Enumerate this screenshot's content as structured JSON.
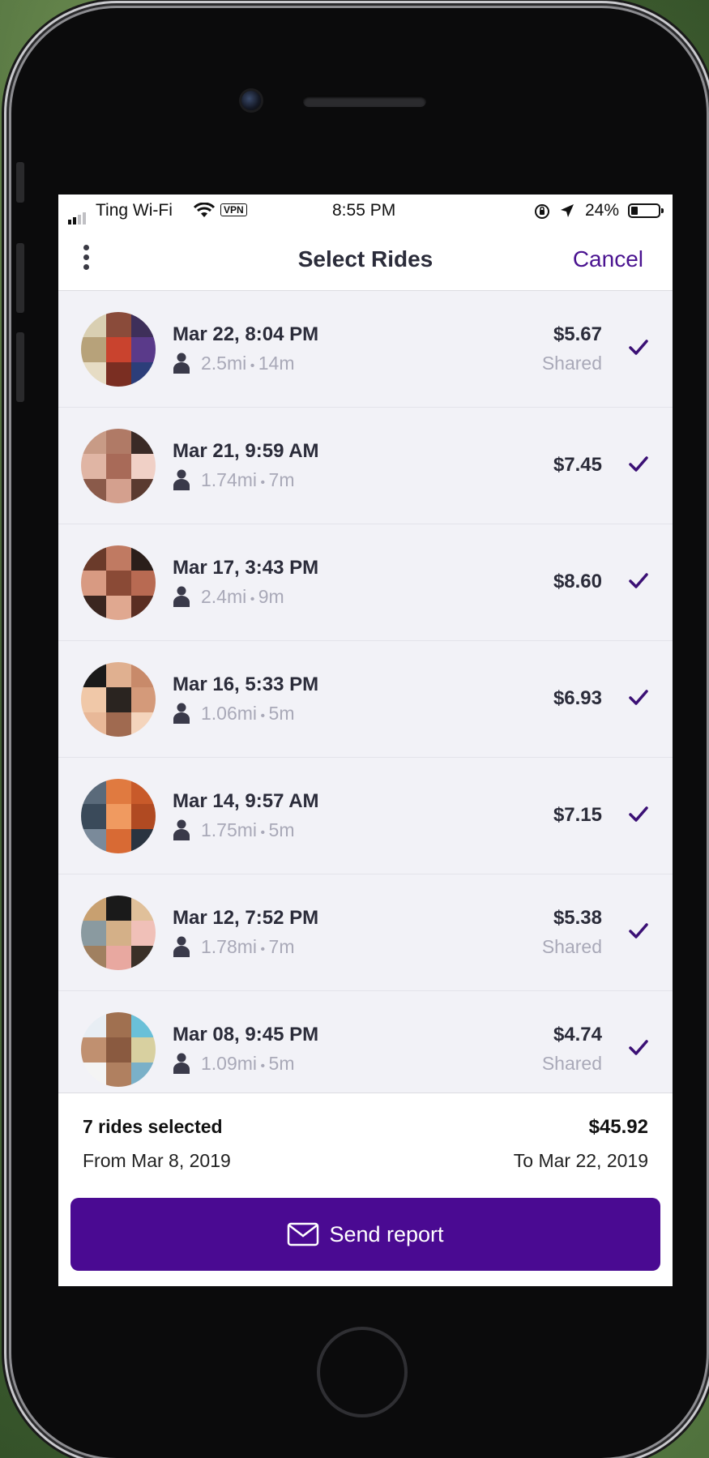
{
  "status_bar": {
    "carrier": "Ting Wi-Fi",
    "vpn_label": "VPN",
    "time": "8:55 PM",
    "battery_percent": "24%",
    "battery_level": 0.24
  },
  "nav": {
    "title": "Select Rides",
    "cancel_label": "Cancel",
    "more_icon": "more-vertical-icon"
  },
  "rides": [
    {
      "date": "Mar 22, 8:04 PM",
      "distance": "2.5mi",
      "duration": "14m",
      "price": "$5.67",
      "type": "Shared",
      "selected": true,
      "avatar_colors": [
        "#d9cfb2",
        "#8a4b3a",
        "#3e2f5a",
        "#b7a27a",
        "#c9432e",
        "#5a3a8a",
        "#e6dcc4",
        "#7a2e22",
        "#2c3e7a"
      ]
    },
    {
      "date": "Mar 21, 9:59 AM",
      "distance": "1.74mi",
      "duration": "7m",
      "price": "$7.45",
      "type": "",
      "selected": true,
      "avatar_colors": [
        "#c89b86",
        "#b07a66",
        "#3a2a26",
        "#e0b5a4",
        "#a86a58",
        "#f0d0c6",
        "#8a5a4a",
        "#d4a08e",
        "#5a3a30"
      ]
    },
    {
      "date": "Mar 17, 3:43 PM",
      "distance": "2.4mi",
      "duration": "9m",
      "price": "$8.60",
      "type": "",
      "selected": true,
      "avatar_colors": [
        "#6a3a2a",
        "#c07a62",
        "#2a1e1a",
        "#d89a82",
        "#8a4a36",
        "#b86a52",
        "#3a2620",
        "#e0a890",
        "#5a2e22"
      ]
    },
    {
      "date": "Mar 16, 5:33 PM",
      "distance": "1.06mi",
      "duration": "5m",
      "price": "$6.93",
      "type": "",
      "selected": true,
      "avatar_colors": [
        "#1a1a1a",
        "#e0b090",
        "#c88a6a",
        "#f0c8a8",
        "#2a2420",
        "#d49a7a",
        "#e8b898",
        "#a06a50",
        "#f4d4bc"
      ]
    },
    {
      "date": "Mar 14, 9:57 AM",
      "distance": "1.75mi",
      "duration": "5m",
      "price": "$7.15",
      "type": "",
      "selected": true,
      "avatar_colors": [
        "#5a6a7a",
        "#e07a40",
        "#c85a2a",
        "#3a4a5a",
        "#f09a60",
        "#b04a22",
        "#7a8a9a",
        "#d86a34",
        "#2a3440"
      ]
    },
    {
      "date": "Mar 12, 7:52 PM",
      "distance": "1.78mi",
      "duration": "7m",
      "price": "$5.38",
      "type": "Shared",
      "selected": true,
      "avatar_colors": [
        "#c8a070",
        "#1a1a1a",
        "#e0c09a",
        "#8a9aa0",
        "#d4b088",
        "#f0c0b8",
        "#a08060",
        "#e8a8a0",
        "#3a3028"
      ]
    },
    {
      "date": "Mar 08, 9:45 PM",
      "distance": "1.09mi",
      "duration": "5m",
      "price": "$4.74",
      "type": "Shared",
      "selected": true,
      "avatar_colors": [
        "#e8eef4",
        "#a07050",
        "#6ac0d8",
        "#c09070",
        "#8a5a40",
        "#d8d0a0",
        "#f4f4f4",
        "#b08060",
        "#7ab0c8"
      ]
    }
  ],
  "summary": {
    "count_label": "7 rides selected",
    "total": "$45.92",
    "from_label": "From Mar 8, 2019",
    "to_label": "To Mar 22, 2019"
  },
  "send_button": {
    "label": "Send report",
    "icon": "envelope-icon",
    "color": "#4a0a92"
  },
  "colors": {
    "accent": "#4a1390",
    "check": "#3b1075",
    "title_text": "#2b2c3a",
    "muted_text": "#a9a9b8",
    "list_bg": "#f2f2f7"
  }
}
